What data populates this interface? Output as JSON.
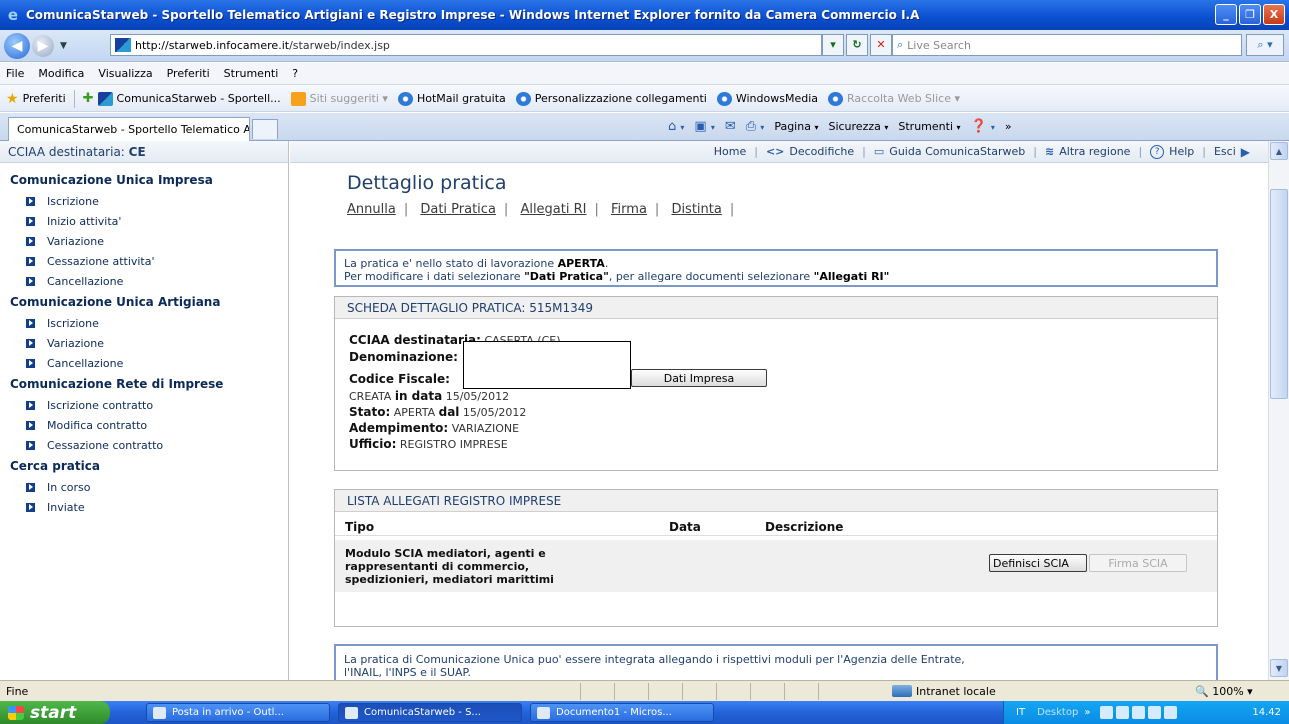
{
  "window": {
    "title": "ComunicaStarweb - Sportello Telematico Artigiani e Registro Imprese - Windows Internet Explorer fornito da Camera Commercio I.A",
    "min": "_",
    "max": "❐",
    "close": "X"
  },
  "address": {
    "url_host": "http://starweb.infocamere.it",
    "url_path": "/starweb/index.jsp",
    "search_placeholder": "Live Search"
  },
  "menu": [
    "File",
    "Modifica",
    "Visualizza",
    "Preferiti",
    "Strumenti",
    "?"
  ],
  "favorites": {
    "label": "Preferiti",
    "items": [
      {
        "label": "ComunicaStarweb - Sportell...",
        "icon": "starweb-icon",
        "muted": false
      },
      {
        "label": "Siti suggeriti ▾",
        "icon": "suggested-sites-icon",
        "muted": true
      },
      {
        "label": "HotMail gratuita",
        "icon": "ie-icon",
        "muted": false
      },
      {
        "label": "Personalizzazione collegamenti",
        "icon": "ie-icon",
        "muted": false
      },
      {
        "label": "WindowsMedia",
        "icon": "ie-icon",
        "muted": false
      },
      {
        "label": "Raccolta Web Slice ▾",
        "icon": "ie-icon",
        "muted": true
      }
    ]
  },
  "tab": {
    "label": "ComunicaStarweb - Sportello Telematico Artigiani e Re..."
  },
  "commandbar": {
    "pagina": "Pagina",
    "sicurezza": "Sicurezza",
    "strumenti": "Strumenti"
  },
  "left": {
    "cciaa_label": "CCIAA destinataria:",
    "cciaa_value": "CE",
    "groups": [
      {
        "title": "Comunicazione Unica Impresa",
        "items": [
          "Iscrizione",
          "Inizio attivita'",
          "Variazione",
          "Cessazione attivita'",
          "Cancellazione"
        ]
      },
      {
        "title": "Comunicazione Unica Artigiana",
        "items": [
          "Iscrizione",
          "Variazione",
          "Cancellazione"
        ]
      },
      {
        "title": "Comunicazione Rete di Imprese",
        "items": [
          "Iscrizione contratto",
          "Modifica contratto",
          "Cessazione contratto"
        ]
      },
      {
        "title": "Cerca pratica",
        "items": [
          "In corso",
          "Inviate"
        ]
      }
    ]
  },
  "toplinks": {
    "home": "Home",
    "decodifiche": "Decodifiche",
    "guida": "Guida ComunicaStarweb",
    "altra": "Altra regione",
    "help": "Help",
    "esci": "Esci"
  },
  "main": {
    "title": "Dettaglio pratica",
    "sublinks": [
      "Annulla",
      "Dati Pratica",
      "Allegati RI",
      "Firma",
      "Distinta"
    ],
    "info_line1_pre": "La pratica e' nello stato di lavorazione ",
    "info_line1_bold": "APERTA",
    "info_line1_post": ".",
    "info_line2_pre": "Per modificare i dati selezionare ",
    "info_line2_b1": "\"Dati Pratica\"",
    "info_line2_mid": ", per allegare documenti selezionare ",
    "info_line2_b2": "\"Allegati RI\"",
    "scheda": {
      "header": "SCHEDA DETTAGLIO PRATICA: 515M1349",
      "cciaa_label": "CCIAA destinataria:",
      "cciaa_value": "CASERTA (CE)",
      "denominazione_label": "Denominazione:",
      "codice_fiscale_label": "Codice Fiscale:",
      "dati_impresa_btn": "Dati Impresa",
      "creata_state": "CREATA",
      "creata_in_data": "in data",
      "creata_date": "15/05/2012",
      "stato_label": "Stato:",
      "stato_value": "APERTA",
      "stato_dal": "dal",
      "stato_date": "15/05/2012",
      "adempimento_label": "Adempimento:",
      "adempimento_value": "VARIAZIONE",
      "ufficio_label": "Ufficio:",
      "ufficio_value": "REGISTRO IMPRESE"
    },
    "lista": {
      "header": "LISTA ALLEGATI REGISTRO IMPRESE",
      "cols": [
        "Tipo",
        "Data",
        "Descrizione"
      ],
      "row_line1": "Modulo SCIA mediatori, agenti e",
      "row_line2": "rappresentanti di commercio,",
      "row_line3": "spedizionieri, mediatori marittimi",
      "btn_definisci": "Definisci SCIA",
      "btn_firma": "Firma SCIA"
    },
    "bottom_line1": "La pratica di Comunicazione Unica puo' essere integrata allegando i rispettivi moduli per l'Agenzia delle Entrate,",
    "bottom_line2": "l'INAIL, l'INPS e il SUAP."
  },
  "status": {
    "text": "Fine",
    "zone": "Intranet locale",
    "zoom": "100%"
  },
  "taskbar": {
    "start": "start",
    "tasks": [
      "Posta in arrivo - Outl...",
      "ComunicaStarweb - S...",
      "Documento1 - Micros..."
    ],
    "lang": "IT",
    "desktop": "Desktop",
    "clock": "14.42"
  }
}
